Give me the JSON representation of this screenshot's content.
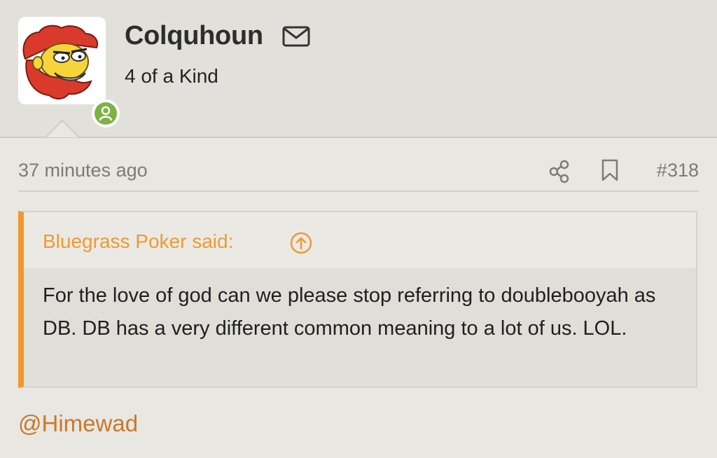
{
  "user": {
    "name": "Colquhoun",
    "title": "4 of a Kind",
    "status": "online",
    "status_color": "#7cb342"
  },
  "post": {
    "time": "37 minutes ago",
    "number": "#318",
    "icons": [
      "share-icon",
      "bookmark-icon"
    ]
  },
  "quote": {
    "author_label": "Bluegrass Poker said:",
    "jump_icon": "arrow-up-circle-icon",
    "text": "For the love of god can we please stop referring to doublebooyah as DB. DB has a very different common meaning to a lot of us. LOL."
  },
  "reply": {
    "mention": "@Himewad"
  },
  "colors": {
    "accent": "#f0982d",
    "link": "#c7792e",
    "muted": "#7d7b76"
  }
}
